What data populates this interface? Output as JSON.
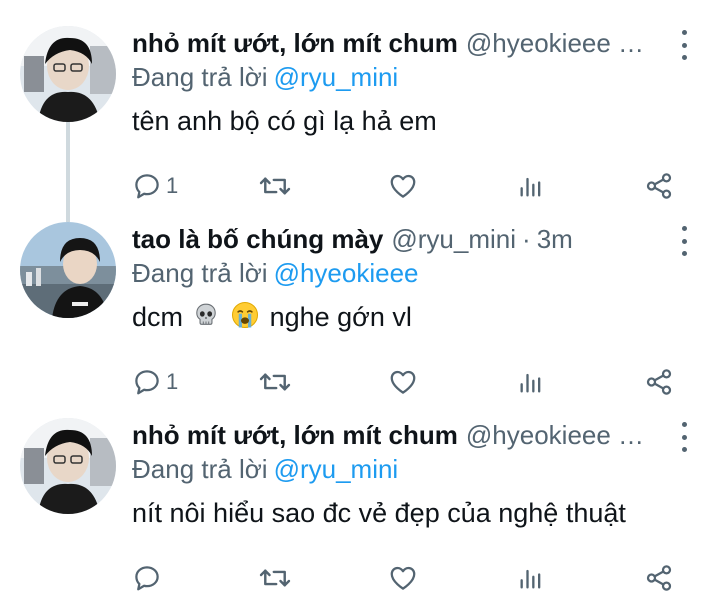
{
  "reply_prefix": "Đang trả lời",
  "tweets": [
    {
      "author_name": "nhỏ mít ướt, lớn mít chum",
      "handle": "@hyeokieee …",
      "time": "",
      "reply_to": "@ryu_mini",
      "text": "tên anh bộ có gì lạ hả em",
      "reply_count": "1"
    },
    {
      "author_name": "tao là bố chúng mày",
      "handle": "@ryu_mini",
      "time": "3m",
      "reply_to": "@hyeokieee",
      "text_before": "dcm",
      "emojis": [
        "skull-emoji",
        "loudly-crying-face-emoji"
      ],
      "text_after": "nghe gớn vl",
      "reply_count": "1"
    },
    {
      "author_name": "nhỏ mít ướt, lớn mít chum",
      "handle": "@hyeokieee …",
      "time": "",
      "reply_to": "@ryu_mini",
      "text": "nít nôi hiểu sao đc vẻ đẹp của nghệ thuật",
      "reply_count": ""
    }
  ],
  "colors": {
    "accent": "#1d9bf0",
    "secondary_text": "#536471",
    "primary_text": "#0f1419",
    "thread_line": "#cfd9de"
  },
  "icons": [
    "reply-icon",
    "retweet-icon",
    "like-icon",
    "views-icon",
    "share-icon",
    "more-icon"
  ]
}
